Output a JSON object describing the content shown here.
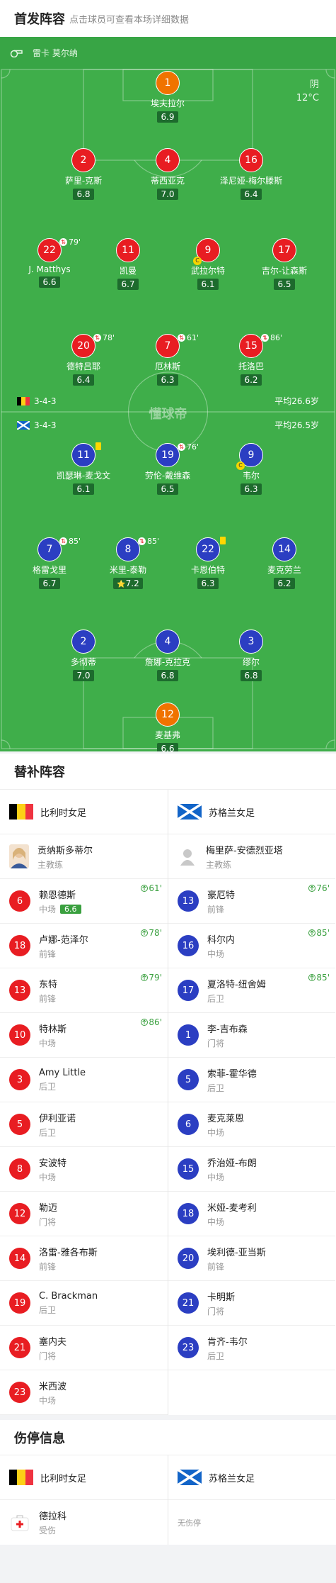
{
  "lineup_header": {
    "title": "首发阵容",
    "subtitle": "点击球员可查看本场详细数据"
  },
  "referee": {
    "label": "雷卡 莫尔纳"
  },
  "weather": {
    "condition": "阴",
    "temperature": "12°C"
  },
  "watermark": "懂球帝",
  "home_team": {
    "name": "比利时女足",
    "formation": "3-4-3",
    "avg_age": "平均26.6岁"
  },
  "away_team": {
    "name": "苏格兰女足",
    "formation": "3-4-3",
    "avg_age": "平均26.5岁"
  },
  "home_players": [
    {
      "num": "1",
      "name": "埃夫拉尔",
      "rating": "6.9",
      "color": "orange"
    },
    {
      "num": "2",
      "name": "萨里-克斯",
      "rating": "6.8",
      "color": "red"
    },
    {
      "num": "4",
      "name": "蒂西亚克",
      "rating": "7.0",
      "color": "red"
    },
    {
      "num": "16",
      "name": "泽尼娅-梅尔滕斯",
      "rating": "6.4",
      "color": "red"
    },
    {
      "num": "22",
      "name": "J. Matthys",
      "rating": "6.6",
      "color": "red",
      "sub_minute": "79'"
    },
    {
      "num": "11",
      "name": "凯曼",
      "rating": "6.7",
      "color": "red"
    },
    {
      "num": "9",
      "name": "武拉尔特",
      "rating": "6.1",
      "color": "red",
      "captain": "C"
    },
    {
      "num": "17",
      "name": "吉尔-让森斯",
      "rating": "6.5",
      "color": "red"
    },
    {
      "num": "20",
      "name": "德特吕耶",
      "rating": "6.4",
      "color": "red",
      "sub_minute": "78'"
    },
    {
      "num": "7",
      "name": "厄林斯",
      "rating": "6.3",
      "color": "red",
      "sub_minute": "61'"
    },
    {
      "num": "15",
      "name": "托洛巴",
      "rating": "6.2",
      "color": "red",
      "sub_minute": "86'"
    }
  ],
  "away_players": [
    {
      "num": "11",
      "name": "凯瑟琳-麦戈文",
      "rating": "6.1",
      "color": "blue",
      "yellow": true
    },
    {
      "num": "19",
      "name": "劳伦-戴维森",
      "rating": "6.5",
      "color": "blue",
      "sub_minute": "76'"
    },
    {
      "num": "9",
      "name": "韦尔",
      "rating": "6.3",
      "color": "blue",
      "captain": "C"
    },
    {
      "num": "7",
      "name": "格雷戈里",
      "rating": "6.7",
      "color": "blue",
      "sub_minute": "85'"
    },
    {
      "num": "8",
      "name": "米里-泰勒",
      "rating": "7.2",
      "color": "blue",
      "sub_minute": "85'",
      "star": "⭐"
    },
    {
      "num": "22",
      "name": "卡恩伯特",
      "rating": "6.3",
      "color": "blue",
      "yellow": true
    },
    {
      "num": "14",
      "name": "麦克劳兰",
      "rating": "6.2",
      "color": "blue"
    },
    {
      "num": "2",
      "name": "多彻蒂",
      "rating": "7.0",
      "color": "blue"
    },
    {
      "num": "4",
      "name": "詹娜-克拉克",
      "rating": "6.8",
      "color": "blue"
    },
    {
      "num": "3",
      "name": "缪尔",
      "rating": "6.8",
      "color": "blue"
    },
    {
      "num": "12",
      "name": "麦基弗",
      "rating": "6.6",
      "color": "orange"
    }
  ],
  "subs_header": {
    "title": "替补阵容"
  },
  "subs": {
    "home_coach": {
      "name": "贡纳斯多蒂尔",
      "role": "主教练"
    },
    "away_coach": {
      "name": "梅里萨-安德烈亚塔",
      "role": "主教练"
    },
    "home": [
      {
        "num": "6",
        "name": "赖恩德斯",
        "pos": "中场",
        "rating": "6.6",
        "in_minute": "61'"
      },
      {
        "num": "18",
        "name": "卢娜-范泽尔",
        "pos": "前锋",
        "in_minute": "78'"
      },
      {
        "num": "13",
        "name": "东特",
        "pos": "前锋",
        "in_minute": "79'"
      },
      {
        "num": "10",
        "name": "特林斯",
        "pos": "中场",
        "in_minute": "86'"
      },
      {
        "num": "3",
        "name": "Amy Little",
        "pos": "后卫"
      },
      {
        "num": "5",
        "name": "伊利亚诺",
        "pos": "后卫"
      },
      {
        "num": "8",
        "name": "安波特",
        "pos": "中场"
      },
      {
        "num": "12",
        "name": "勒迈",
        "pos": "门将"
      },
      {
        "num": "14",
        "name": "洛雷-雅各布斯",
        "pos": "前锋"
      },
      {
        "num": "19",
        "name": "C. Brackman",
        "pos": "后卫"
      },
      {
        "num": "21",
        "name": "塞内夫",
        "pos": "门将"
      },
      {
        "num": "23",
        "name": "米西波",
        "pos": "中场"
      }
    ],
    "away": [
      {
        "num": "13",
        "name": "豪厄特",
        "pos": "前锋",
        "in_minute": "76'"
      },
      {
        "num": "16",
        "name": "科尔内",
        "pos": "中场",
        "in_minute": "85'"
      },
      {
        "num": "17",
        "name": "夏洛特-纽舍姆",
        "pos": "后卫",
        "in_minute": "85'"
      },
      {
        "num": "1",
        "name": "李-吉布森",
        "pos": "门将"
      },
      {
        "num": "5",
        "name": "索菲-霍华德",
        "pos": "后卫"
      },
      {
        "num": "6",
        "name": "麦克莱恩",
        "pos": "中场"
      },
      {
        "num": "15",
        "name": "乔治娅-布朗",
        "pos": "中场"
      },
      {
        "num": "18",
        "name": "米娅-麦考利",
        "pos": "中场"
      },
      {
        "num": "20",
        "name": "埃利德-亚当斯",
        "pos": "前锋"
      },
      {
        "num": "21",
        "name": "卡明斯",
        "pos": "门将"
      },
      {
        "num": "23",
        "name": "肯齐-韦尔",
        "pos": "后卫"
      }
    ]
  },
  "injury_header": {
    "title": "伤停信息"
  },
  "injury": {
    "home": {
      "name": "德拉科",
      "status": "受伤"
    },
    "away_none": "无伤停"
  }
}
